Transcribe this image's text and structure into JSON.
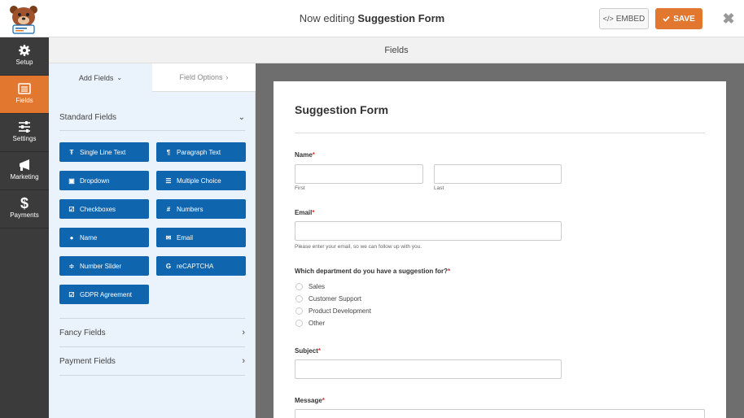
{
  "header": {
    "title_prefix": "Now editing",
    "form_name": "Suggestion Form",
    "embed_label": "EMBED",
    "save_label": "SAVE"
  },
  "leftnav": [
    {
      "label": "Setup",
      "icon": "gear-icon"
    },
    {
      "label": "Fields",
      "icon": "list-icon",
      "active": true
    },
    {
      "label": "Settings",
      "icon": "sliders-icon"
    },
    {
      "label": "Marketing",
      "icon": "megaphone-icon"
    },
    {
      "label": "Payments",
      "icon": "dollar-icon"
    }
  ],
  "section_header": "Fields",
  "panel": {
    "tab_add": "Add Fields",
    "tab_options": "Field Options",
    "standard_title": "Standard Fields",
    "standard_fields": [
      {
        "label": "Single Line Text",
        "icon": "text-icon"
      },
      {
        "label": "Paragraph Text",
        "icon": "paragraph-icon"
      },
      {
        "label": "Dropdown",
        "icon": "dropdown-icon"
      },
      {
        "label": "Multiple Choice",
        "icon": "list-icon"
      },
      {
        "label": "Checkboxes",
        "icon": "checkbox-icon"
      },
      {
        "label": "Numbers",
        "icon": "hash-icon"
      },
      {
        "label": "Name",
        "icon": "user-icon"
      },
      {
        "label": "Email",
        "icon": "envelope-icon"
      },
      {
        "label": "Number Slider",
        "icon": "slider-icon"
      },
      {
        "label": "reCAPTCHA",
        "icon": "google-icon"
      },
      {
        "label": "GDPR Agreement",
        "icon": "checkbox-icon"
      }
    ],
    "fancy_title": "Fancy Fields",
    "payment_title": "Payment Fields"
  },
  "form": {
    "title": "Suggestion Form",
    "name_label": "Name",
    "first_label": "First",
    "last_label": "Last",
    "email_label": "Email",
    "email_help": "Please enter your email, so we can follow up with you.",
    "department_label": "Which department do you have a suggestion for?",
    "department_options": [
      "Sales",
      "Customer Support",
      "Product Development",
      "Other"
    ],
    "subject_label": "Subject",
    "message_label": "Message",
    "required_mark": "*"
  },
  "colors": {
    "accent": "#e27730",
    "field_button": "#0f65ae",
    "nav_bg": "#3b3b3b",
    "panel_bg": "#eaf2fb",
    "canvas_bg": "#6e6e6e"
  }
}
